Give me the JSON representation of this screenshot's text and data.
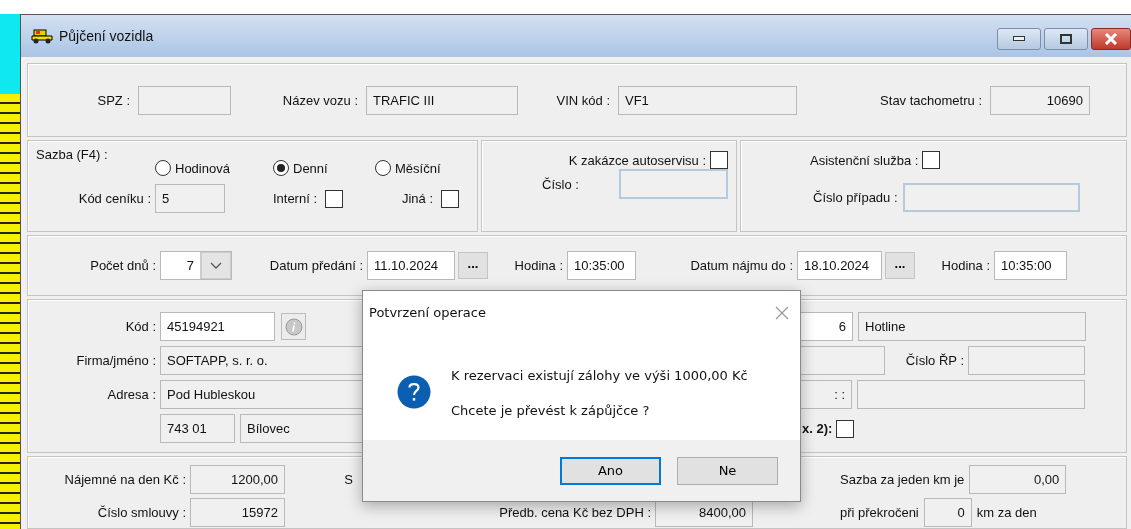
{
  "window": {
    "title": "Půjčení vozidla"
  },
  "vehicle": {
    "spz_label": "SPZ :",
    "name_label": "Název vozu :",
    "name": "TRAFIC III",
    "vin_label": "VIN kód :",
    "vin": "VF1",
    "odometer_label": "Stav tachometru :",
    "odometer": "10690"
  },
  "rate": {
    "label": "Sazba (F4) :",
    "options": [
      {
        "label": "Hodinová",
        "selected": false
      },
      {
        "label": "Denní",
        "selected": true
      },
      {
        "label": "Měsíční",
        "selected": false
      }
    ],
    "price_list_label": "Kód ceníku :",
    "price_list": "5",
    "internal": {
      "label": "Interní :",
      "checked": false
    },
    "other": {
      "label": "Jiná :",
      "checked": false
    }
  },
  "service_order": {
    "label": "K zakázce autoservisu :",
    "checked": false,
    "number_label": "Číslo :"
  },
  "assistance": {
    "label": "Asistenční služba :",
    "checked": false,
    "case_label": "Číslo případu :"
  },
  "period": {
    "days_label": "Počet dnů :",
    "days": "7",
    "handover_label": "Datum předání :",
    "handover_date": "11.10.2024",
    "handover_picker": "...",
    "handover_time_label": "Hodina :",
    "handover_time": "10:35:00",
    "return_label": "Datum nájmu do :",
    "return_date": "18.10.2024",
    "return_picker": "...",
    "return_time_label": "Hodina :",
    "return_time": "10:35:00"
  },
  "customer": {
    "code_label": "Kód :",
    "code": "45194921",
    "company_label": "Firma/jméno :",
    "company": "SOFTAPP, s. r. o.",
    "address_label": "Adresa :",
    "street": "Pod Hubleskou",
    "zip": "743 01",
    "city": "Bílovec",
    "field_1": "6",
    "contact": "Hotline",
    "registration_label": "Číslo ŘP :",
    "field_2": ": :",
    "checkbox_label": "x. 2):",
    "checked": false
  },
  "pricing": {
    "daily_rate_label": "Nájemné na den Kč :",
    "daily_rate": "1200,00",
    "label_1": "S",
    "km_rate_label": "Sazba za jeden km je",
    "km_rate": "0,00",
    "contract_label": "Číslo smlouvy :",
    "contract": "15972",
    "estimate_label": "Předb. cena Kč bez DPH :",
    "estimate": "8400,00",
    "over_label": "při překročeni",
    "over_km": "0",
    "over_unit": "km za den"
  },
  "dialog": {
    "title": "Potvrzení operace",
    "lines": [
      "K rezervaci existují zálohy ve výši 1000,00 Kč",
      "Chcete je převést k zápůjčce ?"
    ],
    "buttons": [
      {
        "label": "Ano",
        "selected": true
      },
      {
        "label": "Ne",
        "selected": false
      }
    ]
  }
}
